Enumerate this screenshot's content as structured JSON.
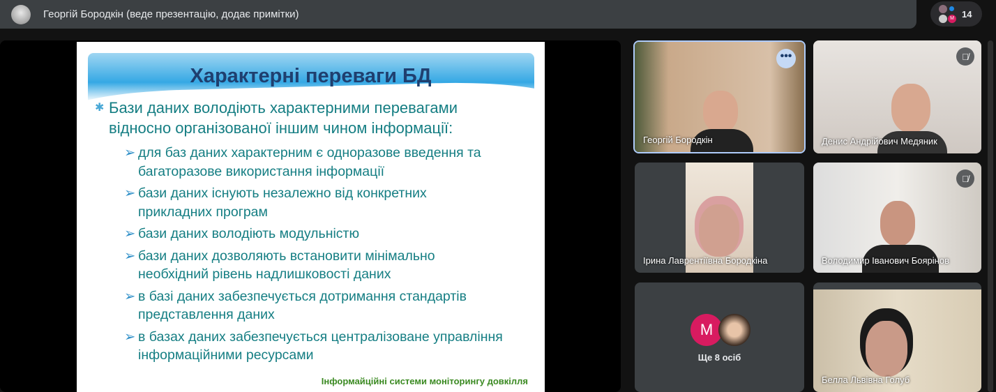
{
  "topbar": {
    "presenter_text": "Георгій Бородкін (веде презентацію, додає примітки)",
    "participant_count": "14",
    "mini_avatar_letter": "M"
  },
  "slide": {
    "title": "Характерні переваги БД",
    "main_bullet": [
      "Бази даних володіють характерними перевагами",
      "відносно організованої іншим чином інформації:"
    ],
    "sub_bullets": [
      [
        "для баз даних характерним є одноразове введення та",
        "багаторазове використання інформації"
      ],
      [
        "бази даних існують незалежно від конкретних",
        "прикладних програм"
      ],
      [
        "бази даних володіють модульністю"
      ],
      [
        "бази даних дозволяють встановити мінімально",
        "необхідний рівень надлишковості даних"
      ],
      [
        "в базі даних забезпечується дотримання стандартів",
        "представлення даних"
      ],
      [
        "в базах даних забезпечується централізоване управління",
        "інформаційними ресурсами"
      ]
    ],
    "footer": "Інформайційні системи моніторингу довкілля"
  },
  "tiles": [
    {
      "name": "Георгій Бородкін",
      "more": "•••"
    },
    {
      "name": "Денис Андрійович Медяник",
      "muted": true
    },
    {
      "name": "Ірина Лаврентіївна Бородкіна"
    },
    {
      "name": "Володимир Іванович Боярінов",
      "muted": true
    },
    {
      "others_label": "Ще 8 осіб",
      "avatar_letter": "M"
    },
    {
      "name": "Белла Львівна Голуб"
    }
  ],
  "colors": {
    "accent_pink": "#d81b60",
    "title_blue": "#1f3f6f",
    "text_teal": "#157e83",
    "footer_green": "#3b8a22"
  }
}
